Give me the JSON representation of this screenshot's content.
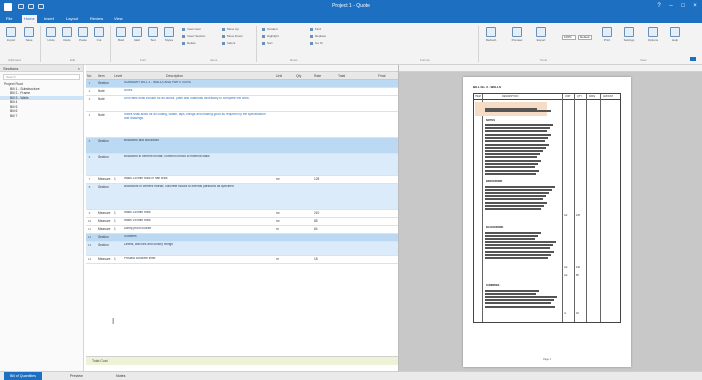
{
  "app": {
    "title": "Project 1 - Quote"
  },
  "ribbon": {
    "tabs": [
      "File",
      "Home",
      "Insert",
      "Layout",
      "Review",
      "View"
    ],
    "active_tab": 1,
    "buttons": [
      {
        "label": "Import"
      },
      {
        "label": "Save"
      },
      {
        "label": "Undo"
      },
      {
        "label": "Redo"
      },
      {
        "label": "Paste"
      },
      {
        "label": "Cut"
      },
      {
        "label": "Bold"
      },
      {
        "label": "Italic"
      },
      {
        "label": "Text"
      },
      {
        "label": "Styles"
      }
    ],
    "small_items": [
      "Insert Item",
      "Insert Section",
      "Delete",
      "Move Up",
      "Move Down",
      "Indent",
      "Outdent",
      "Highlight",
      "Sort",
      "Find",
      "Replace",
      "Go To"
    ],
    "groups": [
      "Clipboard",
      "Edit",
      "Font",
      "Items",
      "Rows",
      "Format",
      "Tools",
      "View"
    ],
    "right_buttons": [
      {
        "label": "Refresh"
      },
      {
        "label": "Preview"
      },
      {
        "label": "Export"
      },
      {
        "label": "Print"
      },
      {
        "label": "Settings"
      },
      {
        "label": "Options"
      },
      {
        "label": "Help"
      }
    ],
    "selects": [
      "100%",
      "Default"
    ]
  },
  "sidebar": {
    "header": "Sections",
    "search_placeholder": "Search",
    "items": [
      {
        "label": "Project Root",
        "sub": false,
        "selected": false
      },
      {
        "label": "Bill 1 - Substructure",
        "sub": true,
        "selected": false
      },
      {
        "label": "Bill 2 - Frame",
        "sub": true,
        "selected": false
      },
      {
        "label": "Bill 3 - Walls",
        "sub": true,
        "selected": true
      },
      {
        "label": "Bill 4",
        "sub": true,
        "selected": false
      },
      {
        "label": "Bill 5",
        "sub": true,
        "selected": false
      },
      {
        "label": "Bill 6",
        "sub": true,
        "selected": false
      },
      {
        "label": "Bill 7",
        "sub": true,
        "selected": false
      }
    ]
  },
  "grid": {
    "columns": [
      "No",
      "Item",
      "Level",
      "Description",
      "Unit",
      "Qty",
      "Rate",
      "Total",
      "Final"
    ],
    "rows": [
      {
        "num": "1",
        "item": "Section",
        "lvl": "",
        "desc": "SUMMARY BILL 3 - WALLS AND PARTITIONS",
        "style": "blue"
      },
      {
        "num": "2",
        "item": "Note",
        "lvl": "",
        "desc": "Notes",
        "style": "link"
      },
      {
        "num": "3",
        "item": "Note",
        "lvl": "",
        "desc": "Unit rates shall include for all labour, plant and materials necessary to complete the work.",
        "style": "link"
      },
      {
        "num": "4",
        "item": "Note",
        "lvl": "",
        "desc": "Rates shall allow for all cutting, waste, laps, fixings and making good as required by the specification and drawings.",
        "style": "link"
      },
      {
        "num": "5",
        "item": "Section",
        "lvl": "",
        "desc": "Brickwork and blockwork",
        "style": "blue"
      },
      {
        "num": "6",
        "item": "Section",
        "lvl": "",
        "desc": "Brickwork in cement mortar; common bricks to external walls",
        "style": "lightblue"
      },
      {
        "num": "7",
        "item": "Measure",
        "lvl": "1",
        "desc": "Walls 230mm thick in half brick",
        "unit": "m²",
        "qty": "125",
        "style": ""
      },
      {
        "num": "8",
        "item": "Section",
        "lvl": "",
        "desc": "Blockwork in cement mortar; concrete blocks to internal partitions as specified",
        "style": "lightblue"
      },
      {
        "num": "9",
        "item": "Measure",
        "lvl": "1",
        "desc": "Walls 140mm thick",
        "unit": "m²",
        "qty": "210",
        "style": ""
      },
      {
        "num": "10",
        "item": "Measure",
        "lvl": "1",
        "desc": "Walls 190mm thick",
        "unit": "m²",
        "qty": "85",
        "style": ""
      },
      {
        "num": "11",
        "item": "Measure",
        "lvl": "1",
        "desc": "Damp proof course",
        "unit": "m",
        "qty": "64",
        "style": ""
      },
      {
        "num": "12",
        "item": "Section",
        "lvl": "",
        "desc": "Sundries",
        "style": "blue"
      },
      {
        "num": "13",
        "item": "Section",
        "lvl": "",
        "desc": "Lintels, wall ties and sundry fixings",
        "style": "lightblue"
      },
      {
        "num": "14",
        "item": "Measure",
        "lvl": "1",
        "desc": "Precast concrete lintel",
        "unit": "nr",
        "qty": "18",
        "style": ""
      }
    ],
    "total_label": "Total Cost"
  },
  "preview": {
    "title": "BILL No. 3 - WALLS",
    "columns": [
      "ITEM",
      "DESCRIPTION",
      "UNIT",
      "QTY",
      "RATE",
      "AMOUNT"
    ],
    "labels": [
      "NOTES",
      "BRICKWORK",
      "BLOCKWORK",
      "SUNDRIES"
    ],
    "values": [
      "m2",
      "125",
      "m2",
      "210",
      "m2",
      "85",
      "nr",
      "18"
    ],
    "footer": "Page 1"
  },
  "statusbar": {
    "tabs": [
      "Bill of Quantities",
      "Preview",
      "Notes"
    ],
    "active": 0
  }
}
